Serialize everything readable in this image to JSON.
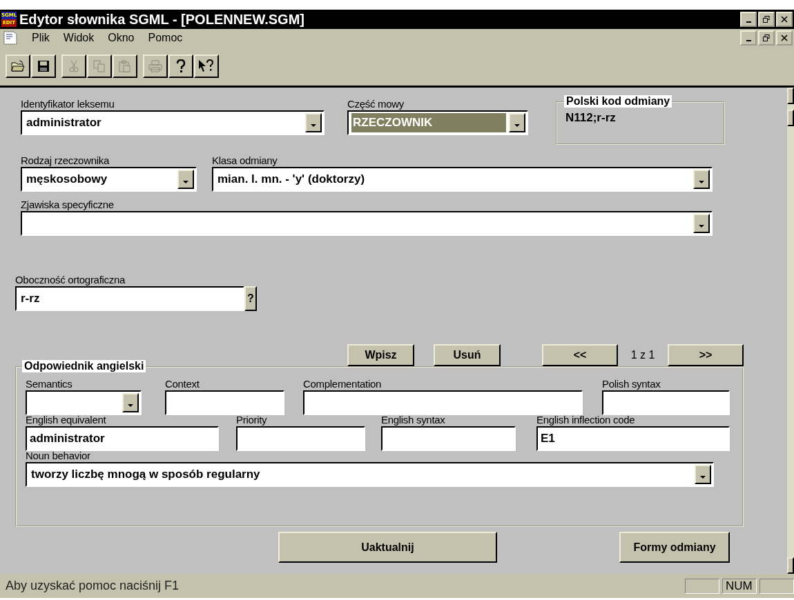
{
  "window": {
    "title": "Edytor słownika SGML - [POLENNEW.SGM]",
    "app_icon": {
      "top": "SGML",
      "bottom": "EDIT"
    }
  },
  "menu": [
    "Plik",
    "Widok",
    "Okno",
    "Pomoc"
  ],
  "toolbar": [
    [
      {
        "kind": "open",
        "disabled": false
      },
      {
        "kind": "save",
        "disabled": false
      }
    ],
    [
      {
        "kind": "cut",
        "disabled": true
      },
      {
        "kind": "copy",
        "disabled": true
      },
      {
        "kind": "paste",
        "disabled": true
      }
    ],
    [
      {
        "kind": "print",
        "disabled": true
      },
      {
        "kind": "help",
        "disabled": false
      },
      {
        "kind": "context-help",
        "disabled": false
      }
    ]
  ],
  "form": {
    "rows": [
      [
        {
          "kind": "dropdown",
          "label": "Identyfikator leksemu",
          "value": "administrator",
          "focused": false
        },
        {
          "kind": "dropdown",
          "label": "Część mowy",
          "value": "RZECZOWNIK",
          "focused": true
        }
      ],
      [
        {
          "kind": "dropdown",
          "label": "Rodzaj rzeczownika",
          "value": "męskosobowy",
          "focused": false
        },
        {
          "kind": "dropdown",
          "label": "Klasa odmiany",
          "value": "mian. l. mn. - 'y' (doktorzy)",
          "focused": false
        }
      ],
      [
        {
          "kind": "dropdown",
          "label": "Zjawiska specyficzne",
          "focused": false
        }
      ],
      [
        {
          "kind": "help",
          "label": "Oboczność ortograficzna",
          "value": "r-rz",
          "button": "?",
          "focused": false
        }
      ]
    ],
    "inflection_code": {
      "title": "Polski kod odmiany",
      "value": "N112;r-rz"
    },
    "actions": [
      "Wpisz",
      "Usuń"
    ],
    "pager": {
      "prev": "<<",
      "position": "1 z 1",
      "next": ">>"
    },
    "english": {
      "title": "Odpowiednik angielski",
      "rows": [
        [
          {
            "kind": "dropdown",
            "label": "Semantics",
            "focused": false
          },
          {
            "kind": "text",
            "label": "Context"
          },
          {
            "kind": "text",
            "label": "Complementation"
          },
          {
            "kind": "text",
            "label": "Polish syntax"
          }
        ],
        [
          {
            "kind": "text",
            "label": "English equivalent",
            "value": "administrator"
          },
          {
            "kind": "text",
            "label": "Priority"
          },
          {
            "kind": "text",
            "label": "English syntax"
          },
          {
            "kind": "text",
            "label": "English inflection code",
            "value": "E1"
          }
        ],
        [
          {
            "kind": "dropdown",
            "label": "Noun behavior",
            "value": "tworzy liczbę mnogą w sposób regularny",
            "focused": false
          }
        ]
      ]
    },
    "bottom_buttons": [
      "Uaktualnij",
      "Formy odmiany"
    ]
  },
  "status_bar": {
    "message": "Aby uzyskać pomoc naciśnij F1",
    "panels": [
      "NUM"
    ]
  }
}
